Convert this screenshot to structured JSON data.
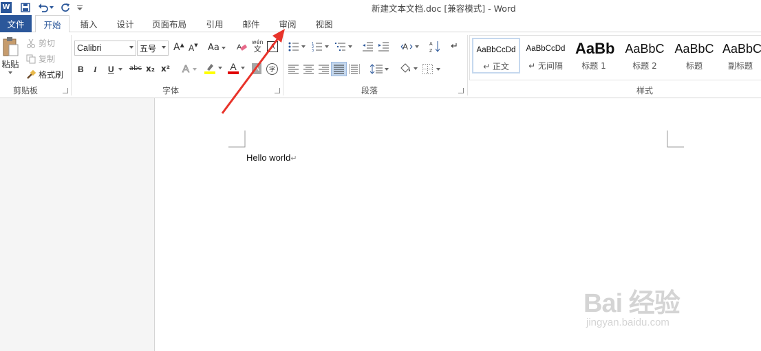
{
  "titlebar": {
    "logo_letter": "W",
    "save_icon": "save-icon",
    "undo_icon": "undo-icon",
    "redo_icon": "redo-icon",
    "customize_icon": "customize-qat-icon",
    "title": "新建文本文档.doc [兼容模式] - Word"
  },
  "tabs": {
    "file": "文件",
    "items": [
      "开始",
      "插入",
      "设计",
      "页面布局",
      "引用",
      "邮件",
      "审阅",
      "视图"
    ],
    "active": "开始"
  },
  "clipboard": {
    "paste": "粘贴",
    "cut": "剪切",
    "copy": "复制",
    "format_painter": "格式刷",
    "label": "剪贴板"
  },
  "font": {
    "name": "Calibri",
    "size": "五号",
    "grow": "A",
    "shrink": "A",
    "change_case": "Aa",
    "bold": "B",
    "italic": "I",
    "underline": "U",
    "strikethrough": "abc",
    "subscript": "x₂",
    "superscript": "x²",
    "text_effects": "A",
    "font_color": "A",
    "highlight_color": "#ffff00",
    "font_color_value": "#e00000",
    "phonetic": "wén",
    "phonetic_char": "文",
    "enclose_char": "字",
    "label": "字体"
  },
  "paragraph": {
    "label": "段落"
  },
  "styles": {
    "items": [
      {
        "sample": "AaBbCcDd",
        "name": "↵ 正文"
      },
      {
        "sample": "AaBbCcDd",
        "name": "↵ 无间隔"
      },
      {
        "sample": "AaBb",
        "name": "标题 1"
      },
      {
        "sample": "AaBbC",
        "name": "标题 2"
      },
      {
        "sample": "AaBbC",
        "name": "标题"
      },
      {
        "sample": "AaBbC",
        "name": "副标题"
      }
    ],
    "label": "样式"
  },
  "document": {
    "text": "Hello world",
    "paragraph_mark": "↵"
  },
  "watermark": {
    "main": "Bai 经验",
    "sub": "jingyan.baidu.com"
  },
  "colors": {
    "brand": "#2b579a",
    "annotation_arrow": "#e8332a"
  }
}
